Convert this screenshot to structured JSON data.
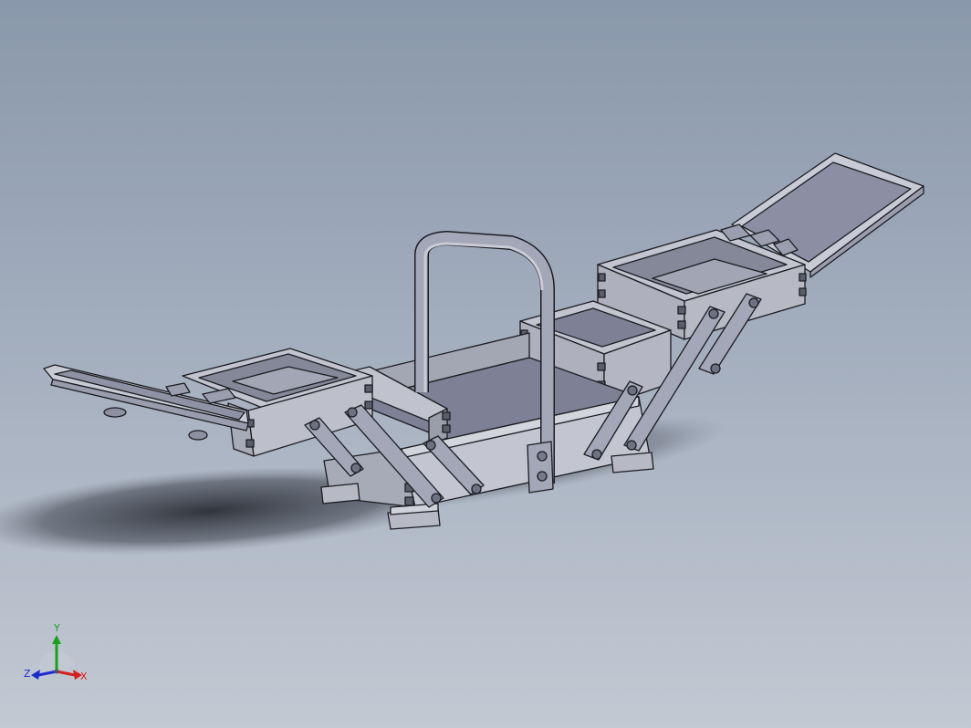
{
  "viewport": {
    "background_top": "#8a98ab",
    "background_bottom": "#c2c9d3",
    "model_subject": "cantilever-toolbox"
  },
  "colors": {
    "model_face_light": "#c5c8d2",
    "model_face_mid": "#a9acb9",
    "model_face_dark": "#7e8195",
    "model_edge": "#1c1c22",
    "shadow": "#30343c"
  },
  "triad": {
    "x_label": "X",
    "y_label": "Y",
    "z_label": "Z",
    "x_color": "#d42020",
    "y_color": "#1aa31a",
    "z_color": "#1c2bd0"
  }
}
